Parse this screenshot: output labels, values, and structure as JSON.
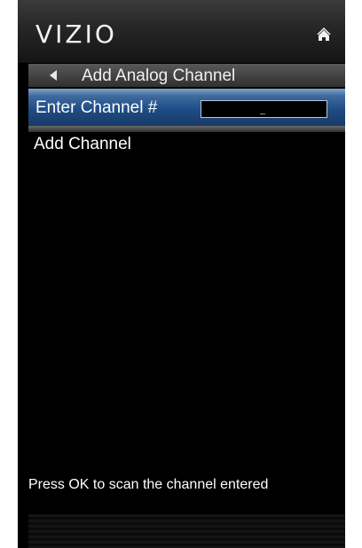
{
  "header": {
    "logo_text": "VIZIO",
    "home_icon": "home-icon"
  },
  "menu": {
    "title": "Add Analog Channel",
    "back_icon": "back-arrow-icon",
    "items": [
      {
        "label": "Enter Channel #",
        "input_value": "_",
        "selected": true
      },
      {
        "label": "Add Channel",
        "selected": false
      }
    ]
  },
  "footer": {
    "hint": "Press OK to scan the channel entered"
  },
  "colors": {
    "selected_row": "#1f4d86",
    "background": "#000000",
    "text": "#ffffff"
  }
}
